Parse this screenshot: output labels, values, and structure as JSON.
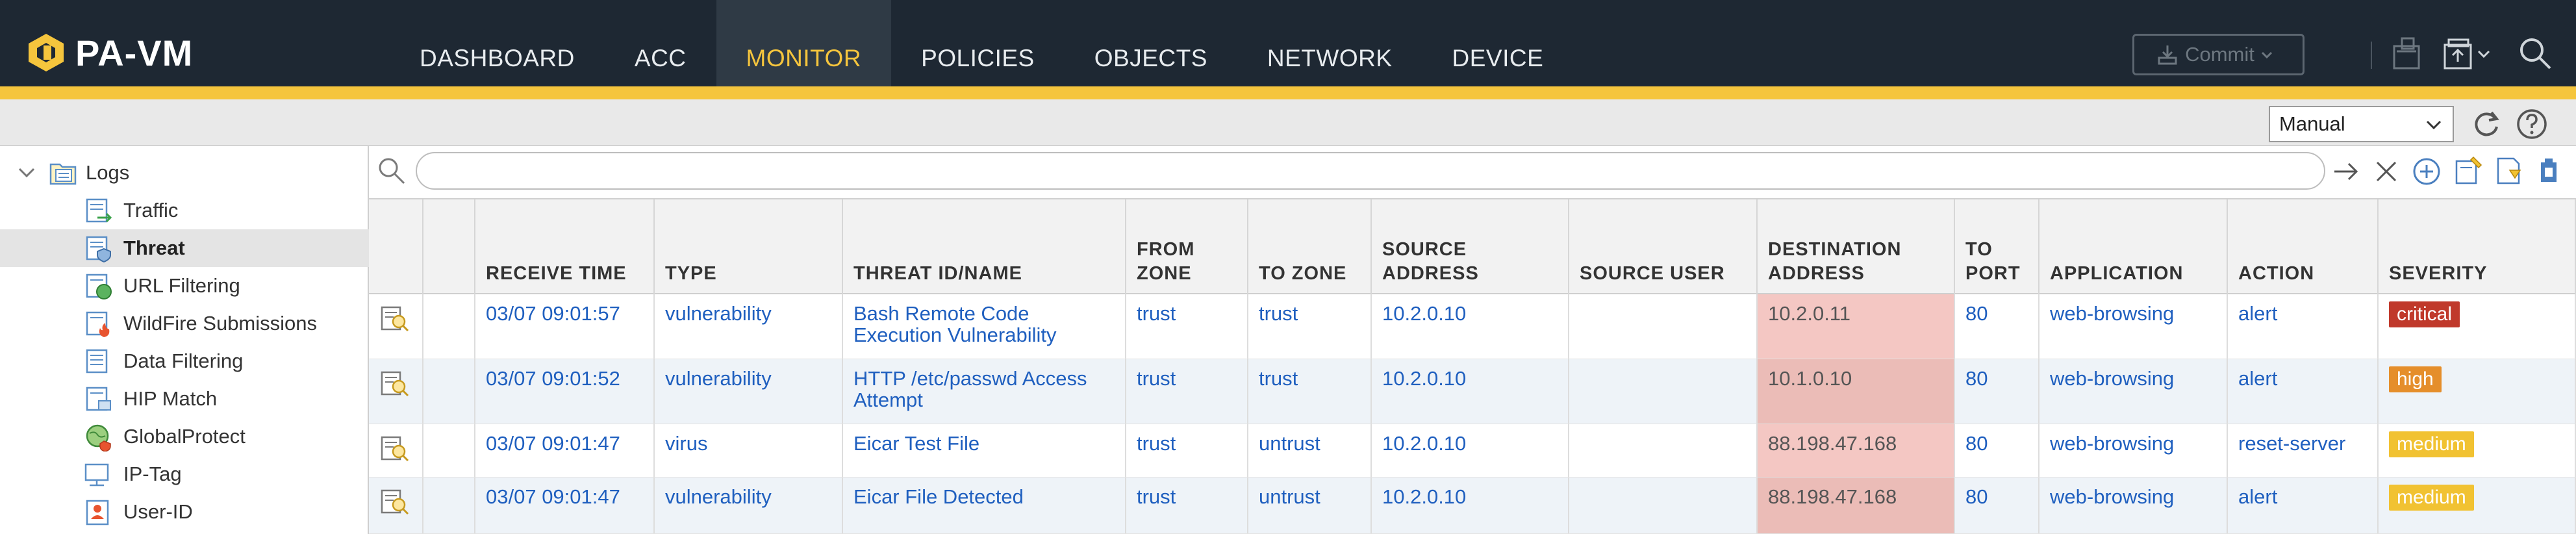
{
  "app": {
    "brand": "PA-VM"
  },
  "nav": {
    "tabs": [
      {
        "label": "DASHBOARD",
        "active": false
      },
      {
        "label": "ACC",
        "active": false
      },
      {
        "label": "MONITOR",
        "active": true
      },
      {
        "label": "POLICIES",
        "active": false
      },
      {
        "label": "OBJECTS",
        "active": false
      },
      {
        "label": "NETWORK",
        "active": false
      },
      {
        "label": "DEVICE",
        "active": false
      }
    ],
    "commit_label": "Commit"
  },
  "toolbar": {
    "refresh_mode": "Manual",
    "icons": [
      "refresh-icon",
      "help-icon"
    ]
  },
  "sidebar": {
    "root": "Logs",
    "items": [
      {
        "label": "Traffic",
        "icon": "traffic-log-icon"
      },
      {
        "label": "Threat",
        "icon": "threat-log-icon",
        "active": true
      },
      {
        "label": "URL Filtering",
        "icon": "url-filtering-icon"
      },
      {
        "label": "WildFire Submissions",
        "icon": "wildfire-icon"
      },
      {
        "label": "Data Filtering",
        "icon": "data-filtering-icon"
      },
      {
        "label": "HIP Match",
        "icon": "hip-match-icon"
      },
      {
        "label": "GlobalProtect",
        "icon": "globalprotect-icon"
      },
      {
        "label": "IP-Tag",
        "icon": "ip-tag-icon"
      },
      {
        "label": "User-ID",
        "icon": "user-id-icon"
      }
    ]
  },
  "filter": {
    "value": "",
    "placeholder": ""
  },
  "table": {
    "columns": [
      "RECEIVE TIME",
      "TYPE",
      "THREAT ID/NAME",
      "FROM ZONE",
      "TO ZONE",
      "SOURCE ADDRESS",
      "SOURCE USER",
      "DESTINATION ADDRESS",
      "TO PORT",
      "APPLICATION",
      "ACTION",
      "SEVERITY"
    ],
    "rows": [
      {
        "receive_time": "03/07 09:01:57",
        "type": "vulnerability",
        "threat": "Bash Remote Code Execution Vulnerability",
        "from_zone": "trust",
        "to_zone": "trust",
        "source_address": "10.2.0.10",
        "source_user": "",
        "destination_address": "10.2.0.11",
        "to_port": "80",
        "application": "web-browsing",
        "action": "alert",
        "severity": "critical"
      },
      {
        "receive_time": "03/07 09:01:52",
        "type": "vulnerability",
        "threat": "HTTP /etc/passwd Access Attempt",
        "from_zone": "trust",
        "to_zone": "trust",
        "source_address": "10.2.0.10",
        "source_user": "",
        "destination_address": "10.1.0.10",
        "to_port": "80",
        "application": "web-browsing",
        "action": "alert",
        "severity": "high"
      },
      {
        "receive_time": "03/07 09:01:47",
        "type": "virus",
        "threat": "Eicar Test File",
        "from_zone": "trust",
        "to_zone": "untrust",
        "source_address": "10.2.0.10",
        "source_user": "",
        "destination_address": "88.198.47.168",
        "to_port": "80",
        "application": "web-browsing",
        "action": "reset-server",
        "severity": "medium"
      },
      {
        "receive_time": "03/07 09:01:47",
        "type": "vulnerability",
        "threat": "Eicar File Detected",
        "from_zone": "trust",
        "to_zone": "untrust",
        "source_address": "10.2.0.10",
        "source_user": "",
        "destination_address": "88.198.47.168",
        "to_port": "80",
        "application": "web-browsing",
        "action": "alert",
        "severity": "medium"
      }
    ]
  },
  "colors": {
    "topbar": "#1e2833",
    "accent": "#f5c53d",
    "link": "#1f5fbf",
    "critical": "#c0392b",
    "high": "#e58e2b",
    "medium": "#f1c232",
    "destination_highlight": "#f4c7c3"
  }
}
